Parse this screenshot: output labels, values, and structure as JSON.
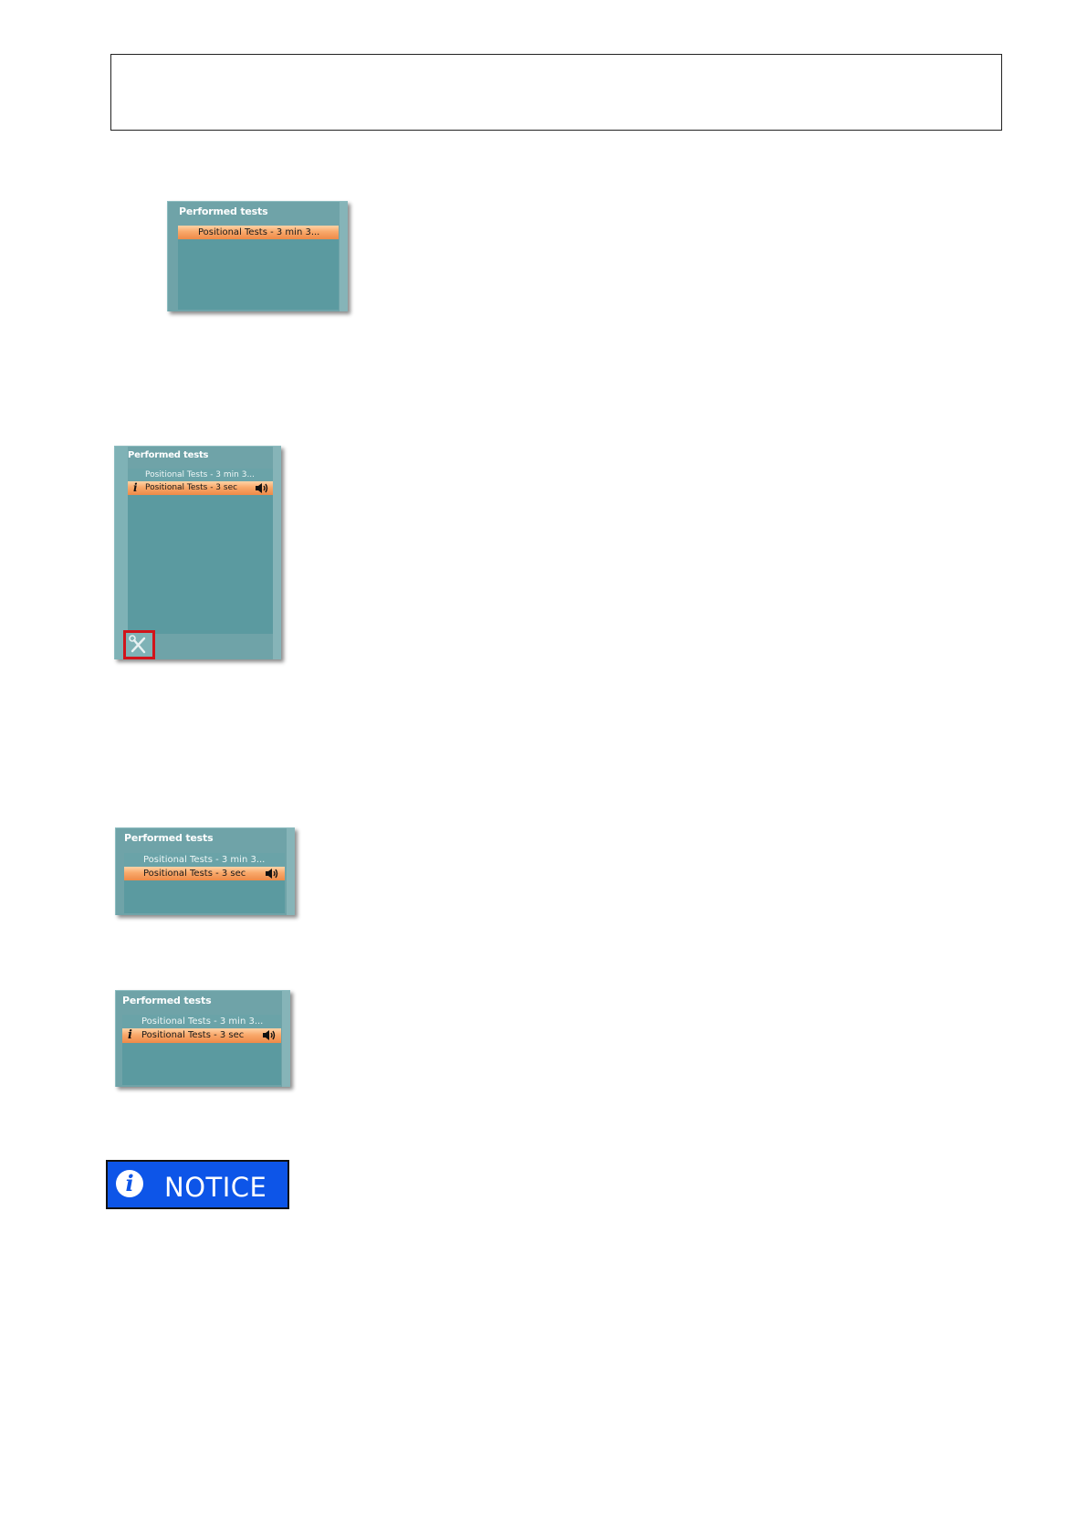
{
  "panels": [
    {
      "title": "Performed tests",
      "rows": [
        {
          "label": "Positional Tests - 3 min 3...",
          "selected": true
        }
      ]
    },
    {
      "title": "Performed tests",
      "rows": [
        {
          "label": "Positional Tests - 3 min 3...",
          "selected": false
        },
        {
          "label": "Positional Tests - 3 sec",
          "selected": true
        }
      ]
    },
    {
      "title": "Performed tests",
      "rows": [
        {
          "label": "Positional Tests - 3 min 3...",
          "selected": false
        },
        {
          "label": "Positional Tests - 3 sec",
          "selected": true
        }
      ]
    },
    {
      "title": "Performed tests",
      "rows": [
        {
          "label": "Positional Tests - 3 min 3...",
          "selected": false
        },
        {
          "label": "Positional Tests - 3 sec",
          "selected": true
        }
      ]
    }
  ],
  "notice": {
    "label": "NOTICE",
    "icon": "info-icon"
  },
  "colors": {
    "panel": "#6fa3a8",
    "selection": "#f9a86a",
    "highlight_border": "#d1141b",
    "notice_bg": "#0d55e8"
  }
}
